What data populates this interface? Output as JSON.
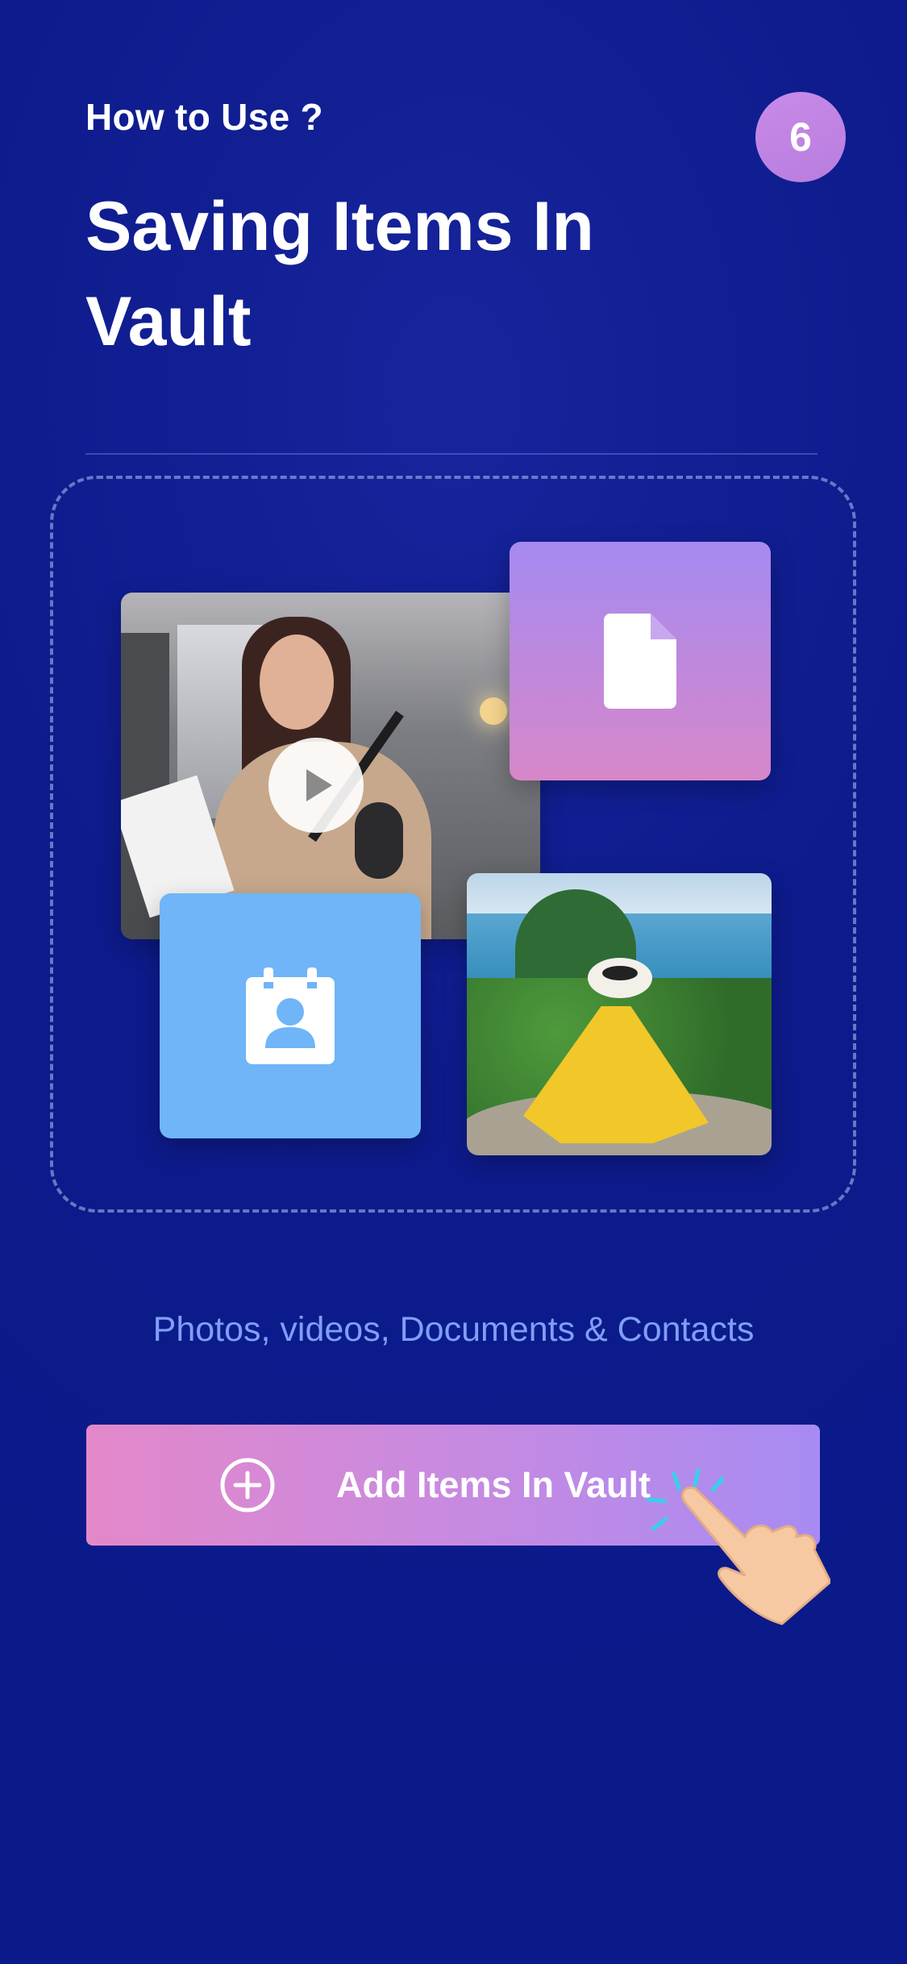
{
  "header": {
    "eyebrow": "How to Use ?",
    "title": "Saving Items In Vault",
    "step_number": "6"
  },
  "illustration": {
    "cards": [
      {
        "name": "video-card",
        "icon": "play-icon"
      },
      {
        "name": "document-card",
        "icon": "document-icon",
        "color": "#a58af1"
      },
      {
        "name": "contact-card",
        "icon": "contact-icon",
        "color": "#6fb5f7"
      },
      {
        "name": "photo-card",
        "icon": "landscape-photo"
      }
    ]
  },
  "caption": "Photos, videos, Documents & Contacts",
  "action": {
    "label": "Add Items In Vault",
    "icon": "plus-circle-icon"
  },
  "colors": {
    "background": "#0d1b8c",
    "accent_pink": "#e388c9",
    "accent_purple": "#a78bf3",
    "caption_blue": "#7f9ff7"
  }
}
